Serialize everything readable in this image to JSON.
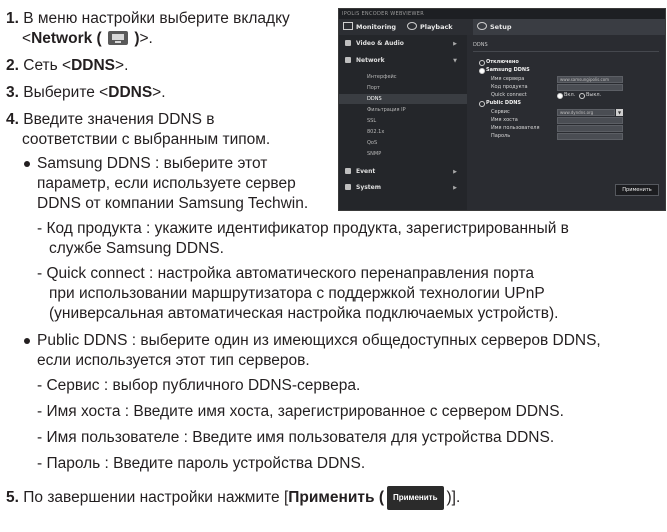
{
  "steps": {
    "s1": {
      "num": "1.",
      "a": "В меню настройки выберите вкладку",
      "b1": "<",
      "b_bold": "Network (",
      "b_bold2": ")",
      "b2": ">."
    },
    "s2": {
      "num": "2.",
      "a": "Сеть <",
      "bold": "DDNS",
      "b": ">."
    },
    "s3": {
      "num": "3.",
      "a": "Выберите <",
      "bold": "DDNS",
      "b": ">."
    },
    "s4": {
      "num": "4.",
      "l1": "Введите значения DDNS в",
      "l2": "соответствии с выбранным типом."
    },
    "b1": {
      "l1": "Samsung DDNS : выберите этот",
      "l2": "параметр, если используете сервер",
      "l3": "DDNS от компании Samsung Techwin."
    },
    "d1": {
      "l1": "Код продукта : укажите идентификатор продукта, зарегистрированный в",
      "l2": "службе Samsung DDNS."
    },
    "d2": {
      "l1": "Quick connect : настройка автоматического перенаправления порта",
      "l2": "при использовании маршрутизатора с поддержкой технологии UPnP",
      "l3": "(универсальная автоматическая настройка подключаемых устройств)."
    },
    "b2": {
      "l1": "Public DDNS : выберите один из имеющихся общедоступных серверов DDNS,",
      "l2": "если используется этот тип серверов."
    },
    "d3": "Сервис : выбор публичного DDNS-сервера.",
    "d4": "Имя хоста : Введите имя хоста, зарегистрированное с сервером DDNS.",
    "d5": "Имя пользователе : Введите имя пользователя для устройства DDNS.",
    "d6": "Пароль : Введите пароль устройства DDNS.",
    "s5": {
      "num": "5.",
      "a": "По завершении настройки нажмите [",
      "bold": "Применить (",
      "btn": "Применить",
      "b": ")]."
    }
  },
  "shot": {
    "brand": "IPOLiS ENCODER WEBVIEWER",
    "tabs": {
      "monitoring": "Monitoring",
      "playback": "Playback",
      "setup": "Setup"
    },
    "sections": {
      "video_audio": "Video & Audio",
      "network": "Network",
      "event": "Event",
      "system": "System"
    },
    "network_items": [
      "Интерфейс",
      "Порт",
      "DDNS",
      "Фильтрация IP",
      "SSL",
      "802.1x",
      "QoS",
      "SNMP"
    ],
    "content_title": "DDNS",
    "options": {
      "off": "Отключено",
      "samsung": "Samsung DDNS",
      "public": "Public DDNS"
    },
    "samsung_fields": {
      "server": "Имя сервера",
      "product": "Код продукта",
      "quick": "Quick connect",
      "on": "Вкл.",
      "off": "Выкл.",
      "server_value": "www.samsungipolis.com"
    },
    "public_fields": {
      "service": "Сервис",
      "host": "Имя хоста",
      "user": "Имя пользователя",
      "password": "Пароль",
      "service_value": "www.dyndns.org"
    },
    "apply": "Применить"
  }
}
